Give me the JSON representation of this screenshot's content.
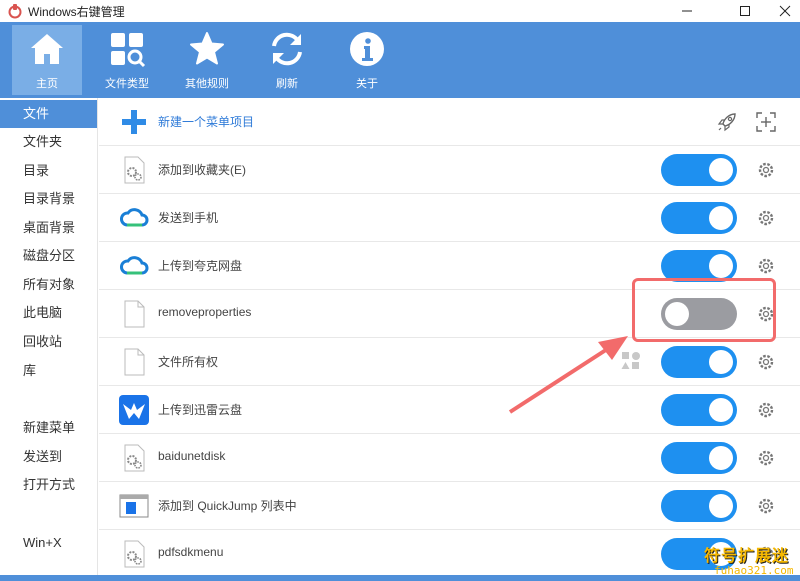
{
  "window": {
    "title": "Windows右键管理"
  },
  "toolbar": {
    "items": [
      {
        "label": "主页",
        "icon": "home-icon"
      },
      {
        "label": "文件类型",
        "icon": "file-types-icon"
      },
      {
        "label": "其他规则",
        "icon": "star-icon"
      },
      {
        "label": "刷新",
        "icon": "refresh-icon"
      },
      {
        "label": "关于",
        "icon": "info-icon"
      }
    ],
    "active_index": 0
  },
  "sidebar": {
    "items": [
      {
        "label": "文件"
      },
      {
        "label": "文件夹"
      },
      {
        "label": "目录"
      },
      {
        "label": "目录背景"
      },
      {
        "label": "桌面背景"
      },
      {
        "label": "磁盘分区"
      },
      {
        "label": "所有对象"
      },
      {
        "label": "此电脑"
      },
      {
        "label": "回收站"
      },
      {
        "label": "库"
      },
      {
        "label": "新建菜单"
      },
      {
        "label": "发送到"
      },
      {
        "label": "打开方式"
      },
      {
        "label": "Win+X"
      }
    ],
    "active_index": 0
  },
  "main": {
    "new_item": {
      "label": "新建一个菜单项目"
    },
    "rows": [
      {
        "label": "添加到收藏夹(E)",
        "icon": "gear-file-icon",
        "enabled": true
      },
      {
        "label": "发送到手机",
        "icon": "cloud-icon",
        "enabled": true
      },
      {
        "label": "上传到夸克网盘",
        "icon": "cloud-icon",
        "enabled": true
      },
      {
        "label": "removeproperties",
        "icon": "blank-file-icon",
        "enabled": false
      },
      {
        "label": "文件所有权",
        "icon": "blank-file-icon",
        "enabled": true
      },
      {
        "label": "上传到迅雷云盘",
        "icon": "thunder-icon",
        "enabled": true
      },
      {
        "label": "baidunetdisk",
        "icon": "gear-file-icon",
        "enabled": true
      },
      {
        "label": "添加到 QuickJump 列表中",
        "icon": "window-app-icon",
        "enabled": true
      },
      {
        "label": "pdfsdkmenu",
        "icon": "gear-file-icon",
        "enabled": true
      }
    ]
  },
  "watermark": {
    "text": "符号扩展迷",
    "sub": "fuhao321.com"
  },
  "colors": {
    "accent": "#4f8fd9",
    "toggle_on": "#1e90f0",
    "toggle_off": "#9b9ca1",
    "highlight": "#f26b6b"
  }
}
